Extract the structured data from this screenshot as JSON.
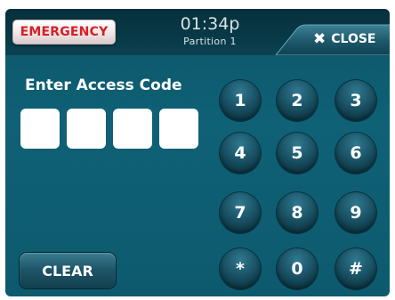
{
  "header": {
    "emergency_label": "EMERGENCY",
    "time": "01:34p",
    "partition": "Partition 1",
    "close_label": "CLOSE",
    "close_icon": "close-x-icon"
  },
  "entry": {
    "prompt": "Enter Access Code",
    "code_length": 4,
    "digits_entered": 0
  },
  "keypad": {
    "keys": [
      "1",
      "2",
      "3",
      "4",
      "5",
      "6",
      "7",
      "8",
      "9",
      "*",
      "0",
      "#"
    ]
  },
  "actions": {
    "clear_label": "CLEAR"
  },
  "colors": {
    "background": "#0f6176",
    "header_background": "#083947",
    "emergency_text": "#d42026",
    "key_face": "#1a5366",
    "text": "#ffffff"
  }
}
